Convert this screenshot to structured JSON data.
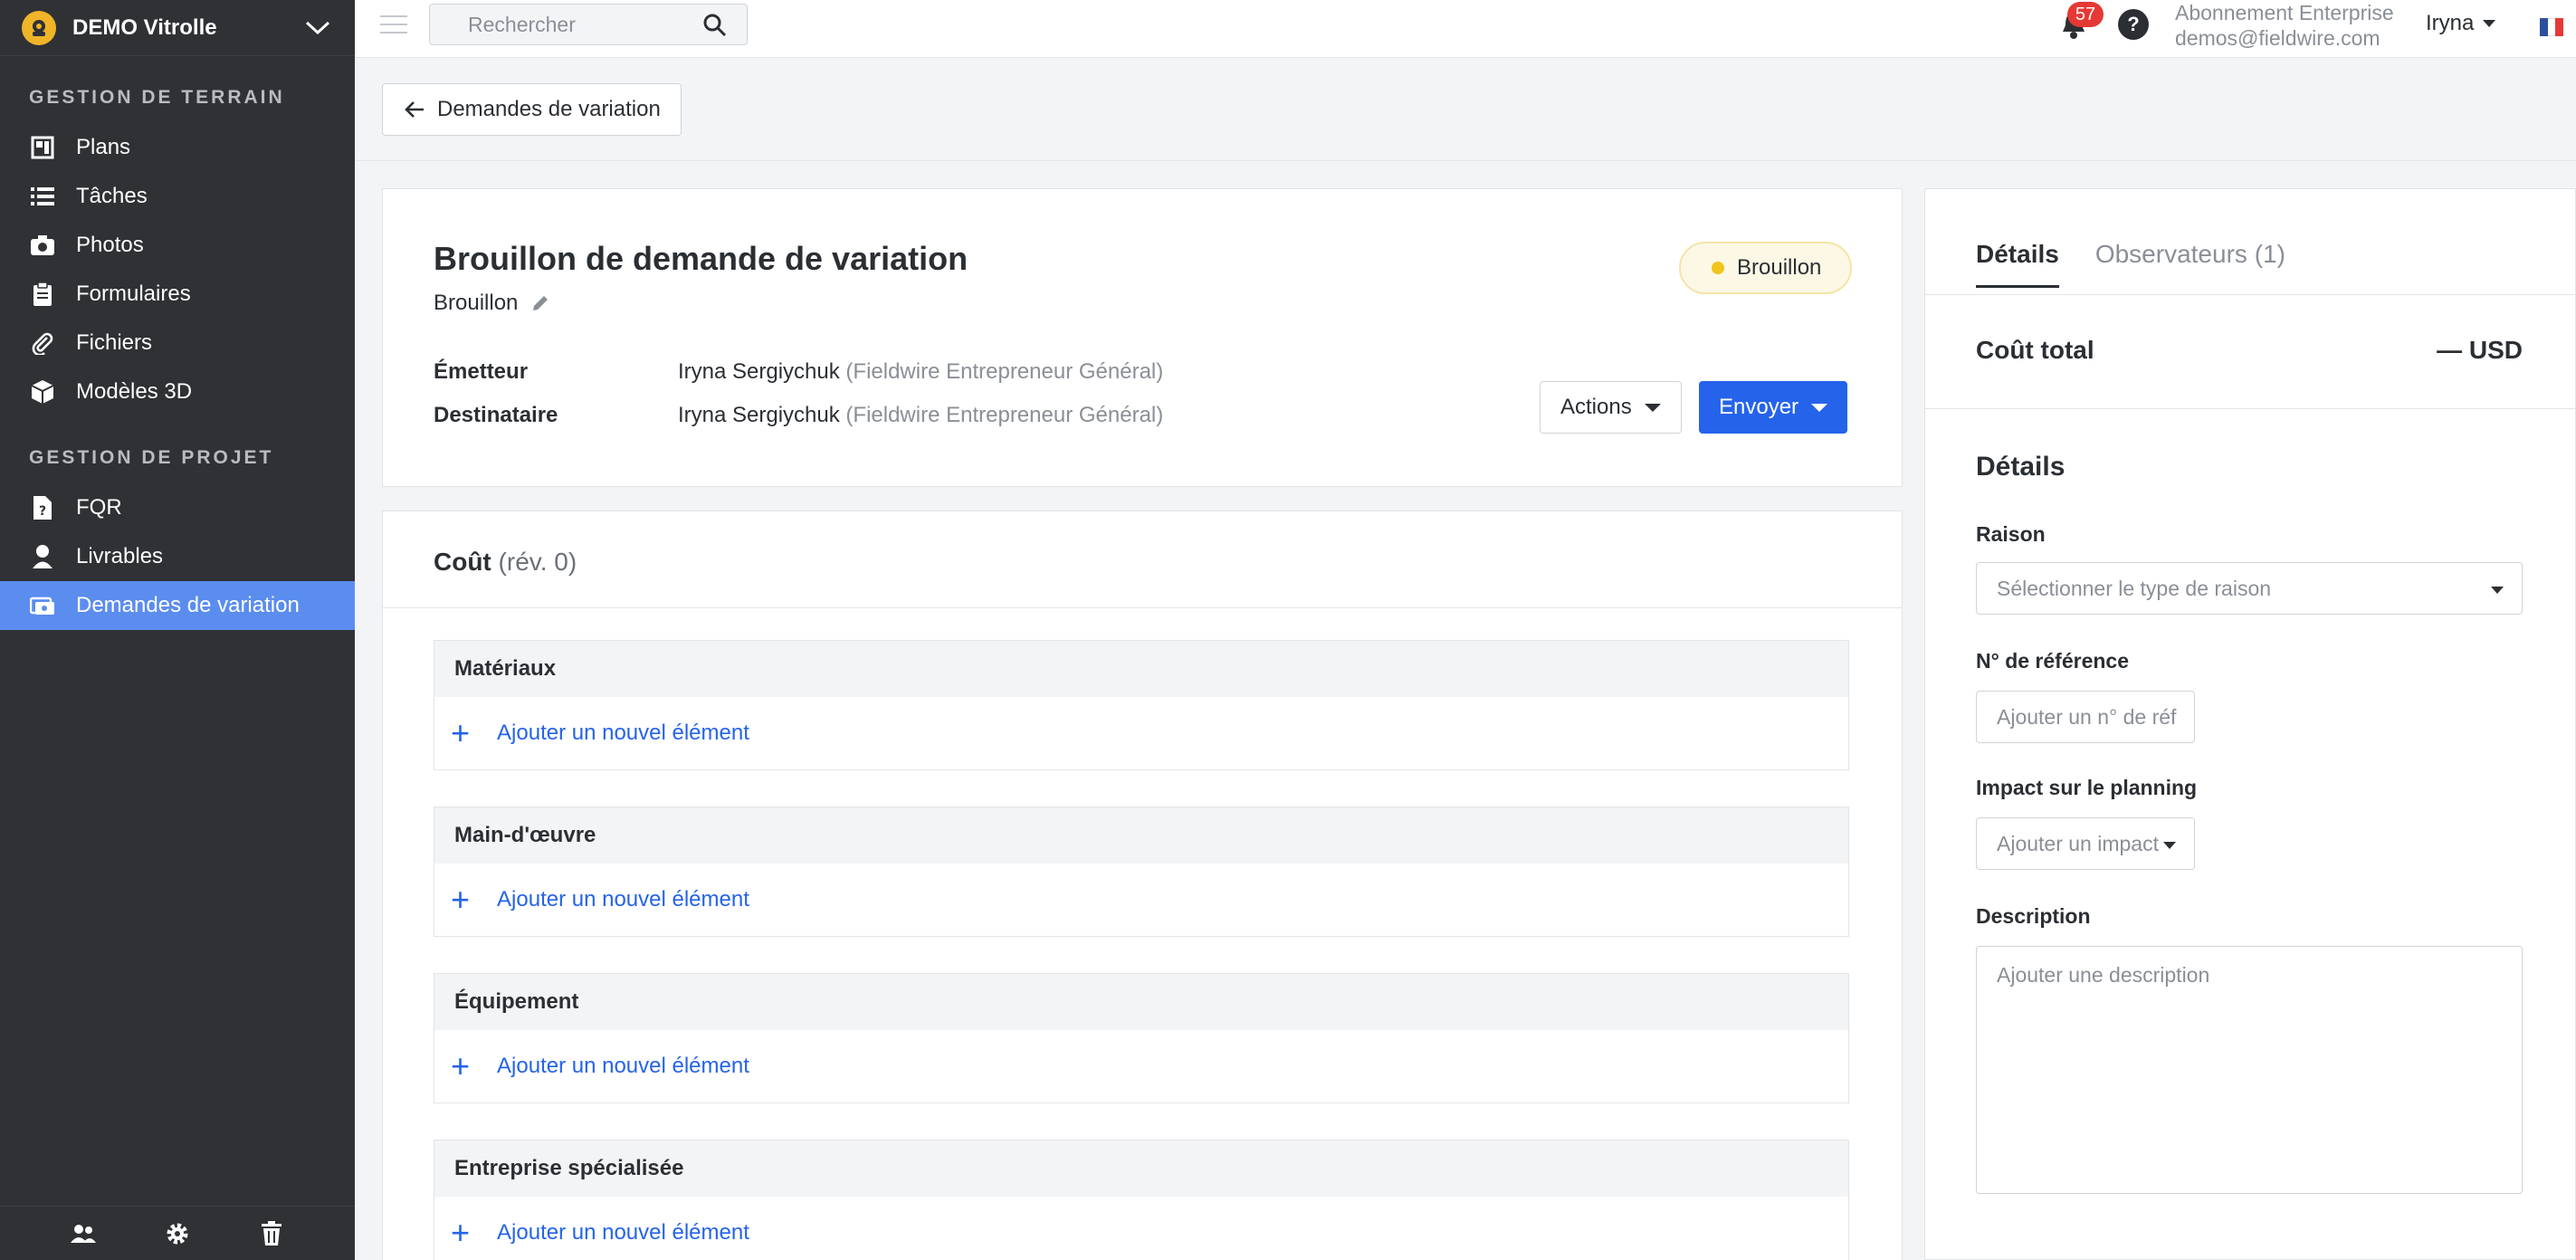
{
  "project": {
    "name": "DEMO Vitrolle"
  },
  "sidebar": {
    "section_field": "GESTION DE TERRAIN",
    "field_items": [
      {
        "label": "Plans",
        "icon": "plans-icon"
      },
      {
        "label": "Tâches",
        "icon": "tasks-icon"
      },
      {
        "label": "Photos",
        "icon": "camera-icon"
      },
      {
        "label": "Formulaires",
        "icon": "clipboard-icon"
      },
      {
        "label": "Fichiers",
        "icon": "paperclip-icon"
      },
      {
        "label": "Modèles 3D",
        "icon": "cube-icon"
      }
    ],
    "section_project": "GESTION DE PROJET",
    "project_items": [
      {
        "label": "FQR",
        "icon": "document-question-icon"
      },
      {
        "label": "Livrables",
        "icon": "person-stamp-icon"
      },
      {
        "label": "Demandes de variation",
        "icon": "change-order-icon"
      }
    ]
  },
  "topbar": {
    "search_placeholder": "Rechercher",
    "notifications_count": "57",
    "help": "?",
    "subscription_line1": "Abonnement Enterprise",
    "subscription_line2": "demos@fieldwire.com",
    "user_name": "Iryna"
  },
  "breadcrumb": {
    "back_label": "Demandes de variation"
  },
  "header": {
    "title": "Brouillon de demande de variation",
    "subtitle": "Brouillon",
    "status": "Brouillon",
    "sender_label": "Émetteur",
    "sender_name": "Iryna Sergiychuk",
    "sender_org": "(Fieldwire Entrepreneur Général)",
    "recipient_label": "Destinataire",
    "recipient_name": "Iryna Sergiychuk",
    "recipient_org": "(Fieldwire Entrepreneur Général)",
    "actions_label": "Actions",
    "send_label": "Envoyer"
  },
  "cost": {
    "title": "Coût",
    "revision": "(rév. 0)",
    "groups": [
      {
        "label": "Matériaux",
        "add": "Ajouter un nouvel élément"
      },
      {
        "label": "Main-d'œuvre",
        "add": "Ajouter un nouvel élément"
      },
      {
        "label": "Équipement",
        "add": "Ajouter un nouvel élément"
      },
      {
        "label": "Entreprise spécialisée",
        "add": "Ajouter un nouvel élément"
      }
    ]
  },
  "details": {
    "tab_details": "Détails",
    "tab_observers": "Observateurs",
    "tab_observers_count": "(1)",
    "total_label": "Coût total",
    "total_value": "— USD",
    "section_title": "Détails",
    "reason_label": "Raison",
    "reason_placeholder": "Sélectionner le type de raison",
    "ref_label": "N° de référence",
    "ref_placeholder": "Ajouter un n° de réf",
    "impact_label": "Impact sur le planning",
    "impact_placeholder": "Ajouter un impact",
    "description_label": "Description",
    "description_placeholder": "Ajouter une description"
  },
  "colors": {
    "sidebar_bg": "#2f3135",
    "active_nav": "#5b8def",
    "primary": "#2563eb",
    "draft_dot": "#f0c419",
    "badge": "#e53935"
  }
}
